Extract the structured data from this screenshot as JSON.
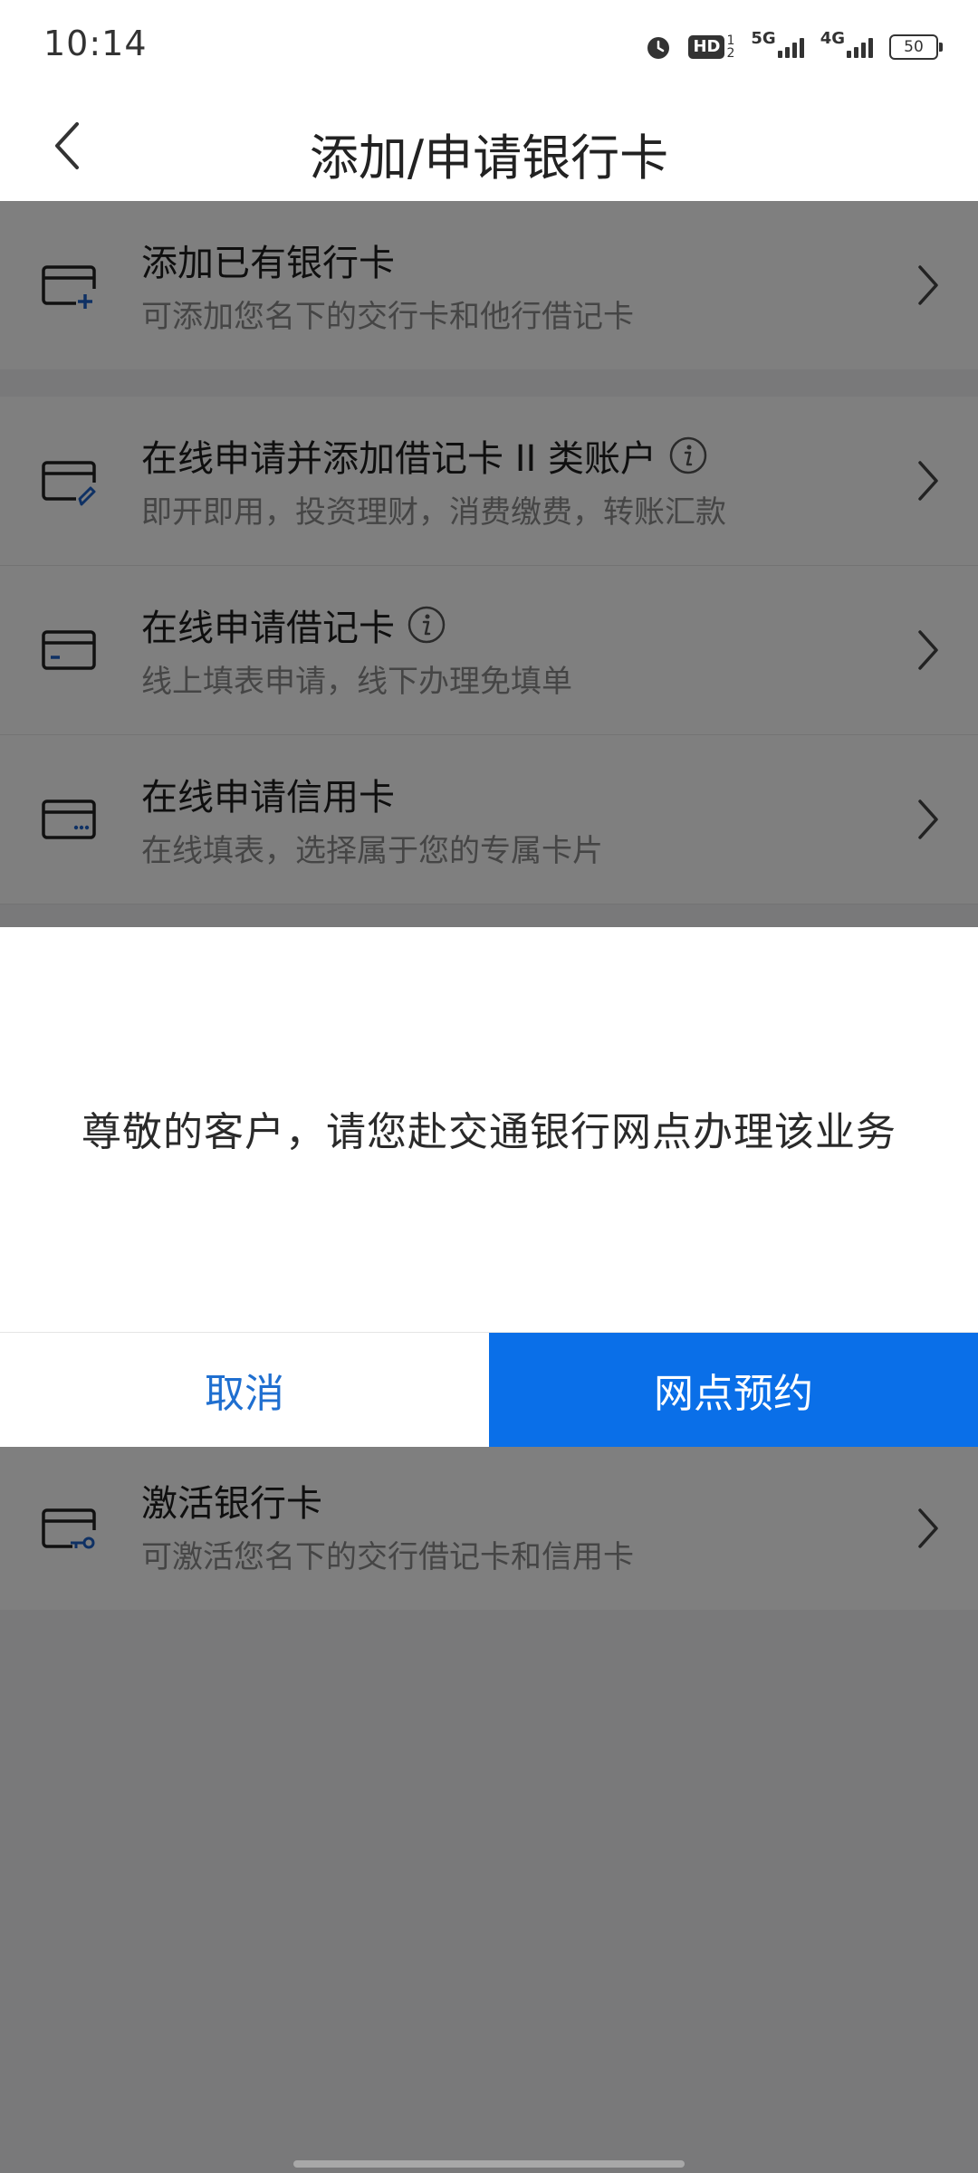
{
  "status_bar": {
    "time": "10:14",
    "hd_label": "HD",
    "hd_sup_top": "1",
    "hd_sup_bottom": "2",
    "net1": "5G",
    "net2": "4G",
    "battery": "50",
    "icons": [
      "alarm-icon",
      "hd-icon",
      "signal-5g-icon",
      "signal-4g-icon",
      "battery-icon"
    ]
  },
  "header": {
    "title": "添加/申请银行卡",
    "back_icon": "chevron-left-icon"
  },
  "items": [
    {
      "title": "添加已有银行卡",
      "subtitle": "可添加您名下的交行卡和他行借记卡",
      "icon": "card-add-icon",
      "has_info": false
    },
    {
      "title": "在线申请并添加借记卡 II 类账户",
      "subtitle": "即开即用，投资理财，消费缴费，转账汇款",
      "icon": "card-edit-icon",
      "has_info": true
    },
    {
      "title": "在线申请借记卡",
      "subtitle": "线上填表申请，线下办理免填单",
      "icon": "debit-card-icon",
      "has_info": true
    },
    {
      "title": "在线申请信用卡",
      "subtitle": "在线填表，选择属于您的专属卡片",
      "icon": "credit-card-icon",
      "has_info": false
    },
    {
      "title": "激活银行卡",
      "subtitle": "可激活您名下的交行借记卡和信用卡",
      "icon": "card-key-icon",
      "has_info": false
    }
  ],
  "dialog": {
    "message": "尊敬的客户，请您赴交通银行网点办理该业务",
    "cancel_label": "取消",
    "confirm_label": "网点预约"
  },
  "colors": {
    "accent": "#0a6fe8",
    "cancel_text": "#1f6fd0",
    "overlay": "rgba(0,0,0,0.5)",
    "icon_accent": "#1e63c9"
  }
}
